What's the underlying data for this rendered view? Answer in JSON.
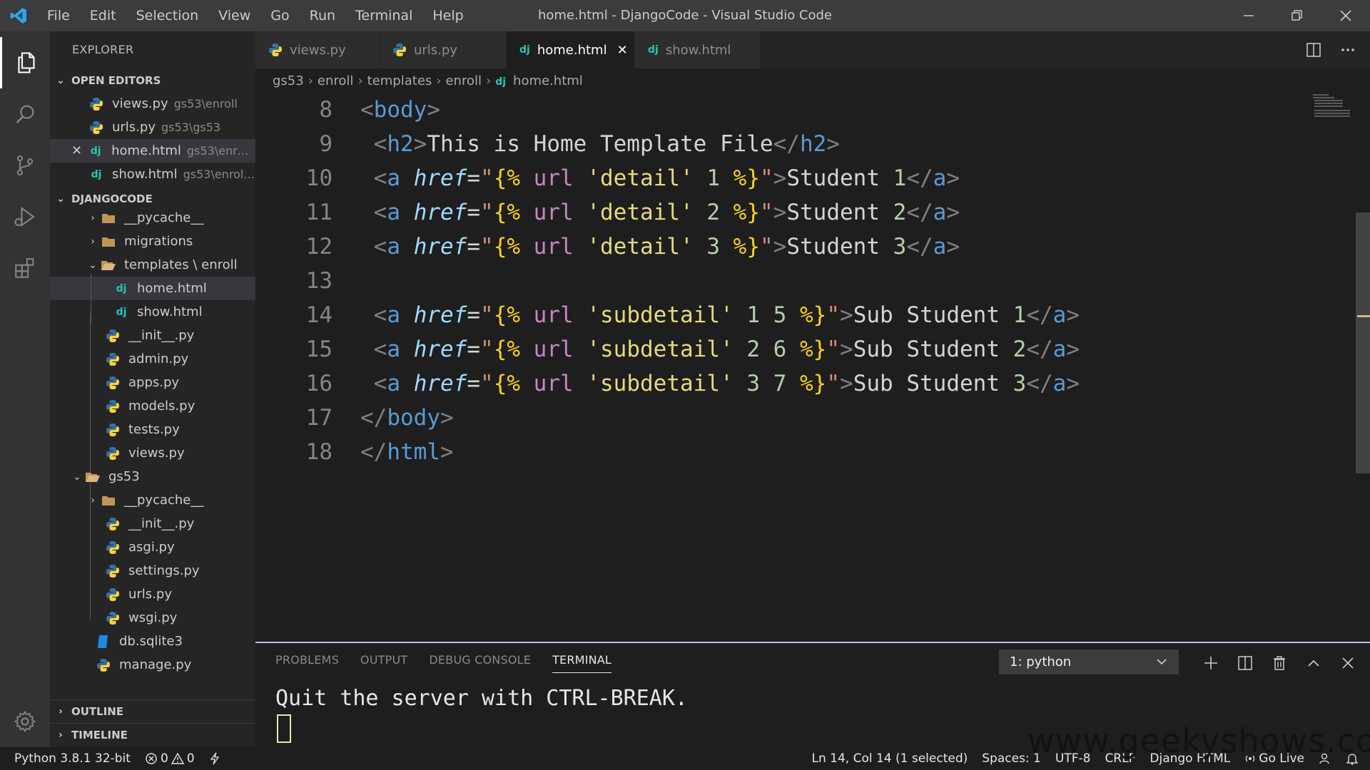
{
  "window": {
    "title": "home.html - DjangoCode - Visual Studio Code",
    "menu": [
      "File",
      "Edit",
      "Selection",
      "View",
      "Go",
      "Run",
      "Terminal",
      "Help"
    ]
  },
  "sidebar": {
    "title": "EXPLORER",
    "open_editors": {
      "label": "OPEN EDITORS",
      "items": [
        {
          "name": "views.py",
          "path": "gs53\\enroll",
          "type": "python"
        },
        {
          "name": "urls.py",
          "path": "gs53\\gs53",
          "type": "python"
        },
        {
          "name": "home.html",
          "path": "gs53\\enrol...",
          "type": "django"
        },
        {
          "name": "show.html",
          "path": "gs53\\enroll...",
          "type": "django"
        }
      ]
    },
    "project": {
      "label": "DJANGOCODE",
      "items": [
        "__pycache__",
        "migrations",
        "templates \\ enroll",
        "home.html",
        "show.html",
        "__init__.py",
        "admin.py",
        "apps.py",
        "models.py",
        "tests.py",
        "views.py",
        "gs53",
        "__pycache__",
        "__init__.py",
        "asgi.py",
        "settings.py",
        "urls.py",
        "wsgi.py",
        "db.sqlite3",
        "manage.py"
      ]
    },
    "outline": "OUTLINE",
    "timeline": "TIMELINE"
  },
  "tabs": [
    {
      "label": "views.py",
      "type": "python",
      "active": false
    },
    {
      "label": "urls.py",
      "type": "python",
      "active": false
    },
    {
      "label": "home.html",
      "type": "django",
      "active": true
    },
    {
      "label": "show.html",
      "type": "django",
      "active": false
    }
  ],
  "breadcrumb": [
    "gs53",
    "enroll",
    "templates",
    "enroll",
    "home.html"
  ],
  "editor": {
    "line_numbers": [
      "8",
      "9",
      "10",
      "11",
      "12",
      "13",
      "14",
      "15",
      "16",
      "17",
      "18"
    ],
    "lines": [
      "<body>",
      " <h2>This is Home Template File</h2>",
      " <a href=\"{% url 'detail' 1 %}\">Student 1</a>",
      " <a href=\"{% url 'detail' 2 %}\">Student 2</a>",
      " <a href=\"{% url 'detail' 3 %}\">Student 3</a>",
      "",
      " <a href=\"{% url 'subdetail' 1 5 %}\">Sub Student 1</a>",
      " <a href=\"{% url 'subdetail' 2 6 %}\">Sub Student 2</a>",
      " <a href=\"{% url 'subdetail' 3 7 %}\">Sub Student 3</a>",
      "</body>",
      "</html>"
    ]
  },
  "panel": {
    "tabs": [
      "PROBLEMS",
      "OUTPUT",
      "DEBUG CONSOLE",
      "TERMINAL"
    ],
    "active_tab": "TERMINAL",
    "terminal_select": "1: python",
    "terminal_output": "Quit the server with CTRL-BREAK."
  },
  "status": {
    "python": "Python 3.8.1 32-bit",
    "errors": "0",
    "warnings": "0",
    "cursor": "Ln 14, Col 14 (1 selected)",
    "spaces": "Spaces: 1",
    "encoding": "UTF-8",
    "eol": "CRLF",
    "language": "Django HTML",
    "golive": "Go Live"
  },
  "watermark": "www.geekyshows.com",
  "colors": {
    "accent": "#007acc",
    "django_icon": "#24c7b3",
    "python_blue": "#3572a5",
    "python_yellow": "#ffd43b"
  }
}
